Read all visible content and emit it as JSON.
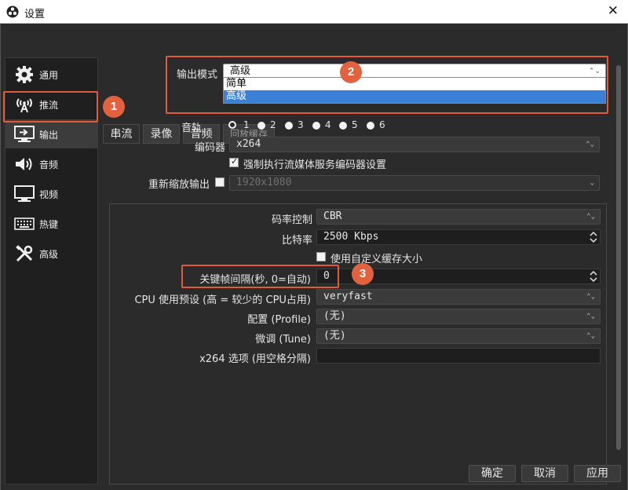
{
  "window": {
    "title": "设置",
    "close_glyph": "✕"
  },
  "sidebar": {
    "items": [
      {
        "label": "通用",
        "icon": "gear-icon"
      },
      {
        "label": "推流",
        "icon": "broadcast-icon"
      },
      {
        "label": "输出",
        "icon": "output-icon",
        "active": true
      },
      {
        "label": "音频",
        "icon": "speaker-icon"
      },
      {
        "label": "视频",
        "icon": "monitor-icon"
      },
      {
        "label": "热键",
        "icon": "keyboard-icon"
      },
      {
        "label": "高级",
        "icon": "tools-icon"
      }
    ]
  },
  "output_mode": {
    "label": "输出模式",
    "value": "高级",
    "options": [
      "简单",
      "高级"
    ],
    "highlighted": "高级",
    "obscured_hint": "回放缓存"
  },
  "tabs": [
    "串流",
    "录像",
    "音频"
  ],
  "audio_track": {
    "label": "音轨",
    "options": [
      "1",
      "2",
      "3",
      "4",
      "5",
      "6"
    ],
    "selected": "1"
  },
  "encoder": {
    "label": "编码器",
    "value": "x264"
  },
  "enforce_settings": {
    "label": "强制执行流媒体服务编码器设置",
    "checked": true
  },
  "rescale": {
    "label": "重新缩放输出",
    "checked": false,
    "value": "1920x1080"
  },
  "rate_control": {
    "label": "码率控制",
    "value": "CBR"
  },
  "bitrate": {
    "label": "比特率",
    "value": "2500 Kbps"
  },
  "custom_buffer": {
    "label": "使用自定义缓存大小",
    "checked": false
  },
  "keyframe": {
    "label": "关键帧间隔(秒, 0=自动)",
    "value": "0"
  },
  "cpu_preset": {
    "label": "CPU 使用预设 (高 = 较少的 CPU占用)",
    "value": "veryfast"
  },
  "profile": {
    "label": "配置 (Profile)",
    "value": "(无)"
  },
  "tune": {
    "label": "微调 (Tune)",
    "value": "(无)"
  },
  "x264_opts": {
    "label": "x264 选项 (用空格分隔)",
    "value": ""
  },
  "annotations": {
    "badge1": "1",
    "badge2": "2",
    "badge3": "3",
    "color": "#e35a3a"
  },
  "buttons": {
    "ok": "确定",
    "cancel": "取消",
    "apply": "应用"
  }
}
